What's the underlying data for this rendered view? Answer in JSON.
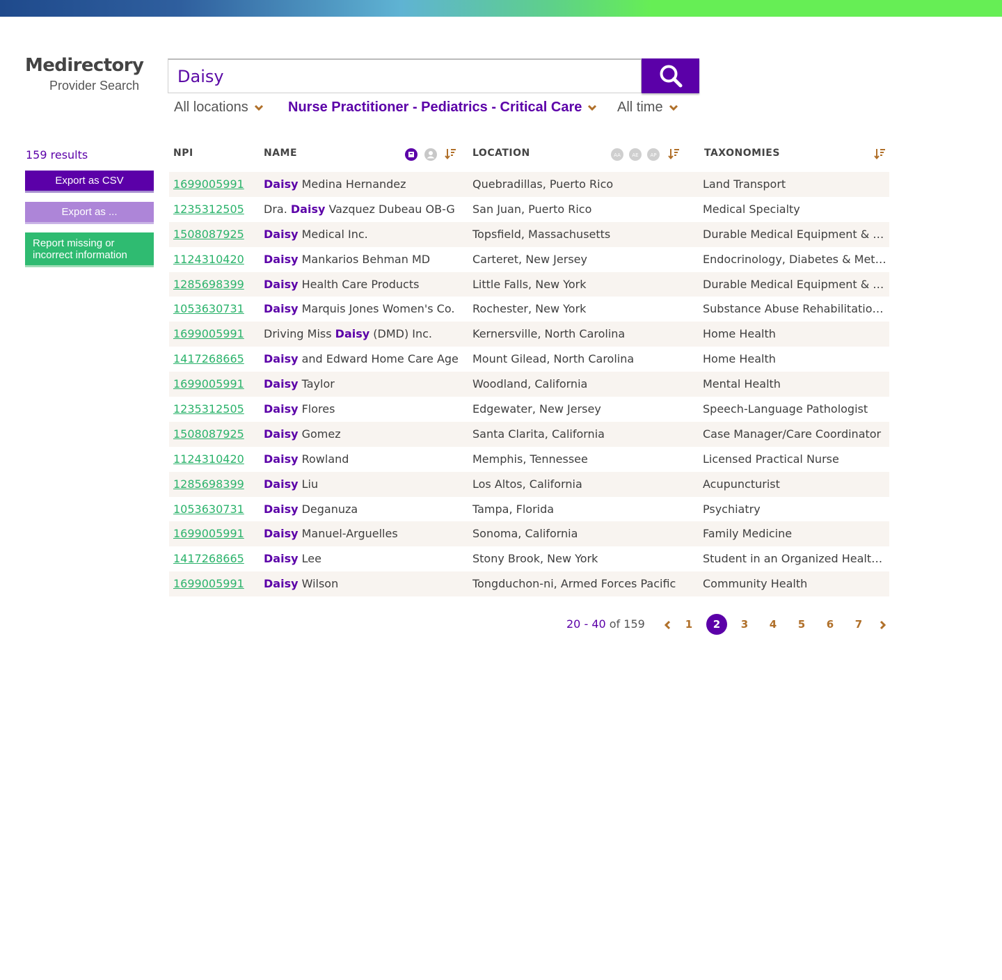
{
  "brand": {
    "title": "Medirectory",
    "subtitle": "Provider Search"
  },
  "search": {
    "value": "Daisy",
    "button_icon": "search-icon"
  },
  "filters": {
    "location": "All locations",
    "taxonomy": "Nurse Practitioner - Pediatrics - Critical Care",
    "time": "All time"
  },
  "sidebar": {
    "results": "159 results",
    "export_csv": "Export as CSV",
    "export_other": "Export as ...",
    "report_line1": "Report missing or",
    "report_line2": "incorrect information"
  },
  "table": {
    "headers": {
      "npi": "NPI",
      "name": "NAME",
      "location": "LOCATION",
      "taxonomies": "TAXONOMIES"
    },
    "name_filters": [
      "organization-icon",
      "person-icon"
    ],
    "location_badges": [
      "AA",
      "AE",
      "AP"
    ],
    "rows": [
      {
        "npi": "1699005991",
        "name_pre": "",
        "name_hl": "Daisy",
        "name_post": " Medina Hernandez",
        "location": "Quebradillas, Puerto Rico",
        "taxonomy": "Land Transport"
      },
      {
        "npi": "1235312505",
        "name_pre": "Dra. ",
        "name_hl": "Daisy",
        "name_post": " Vazquez Dubeau OB-G",
        "location": "San Juan, Puerto Rico",
        "taxonomy": "Medical Specialty"
      },
      {
        "npi": "1508087925",
        "name_pre": "",
        "name_hl": "Daisy",
        "name_post": " Medical Inc.",
        "location": "Topsfield, Massachusetts",
        "taxonomy": "Durable Medical Equipment & M..."
      },
      {
        "npi": "1124310420",
        "name_pre": "",
        "name_hl": "Daisy",
        "name_post": " Mankarios Behman MD",
        "location": "Carteret, New Jersey",
        "taxonomy": "Endocrinology, Diabetes & Meta..."
      },
      {
        "npi": "1285698399",
        "name_pre": "",
        "name_hl": "Daisy",
        "name_post": " Health Care Products",
        "location": "Little Falls, New York",
        "taxonomy": "Durable Medical Equipment & M..."
      },
      {
        "npi": "1053630731",
        "name_pre": "",
        "name_hl": "Daisy",
        "name_post": " Marquis Jones Women's Co.",
        "location": "Rochester, New York",
        "taxonomy": "Substance Abuse Rehabilitation ..."
      },
      {
        "npi": "1699005991",
        "name_pre": "Driving Miss ",
        "name_hl": "Daisy",
        "name_post": " (DMD) Inc.",
        "location": "Kernersville, North Carolina",
        "taxonomy": "Home Health"
      },
      {
        "npi": "1417268665",
        "name_pre": "",
        "name_hl": "Daisy",
        "name_post": " and Edward Home Care Age",
        "location": "Mount Gilead, North Carolina",
        "taxonomy": "Home Health"
      },
      {
        "npi": "1699005991",
        "name_pre": "",
        "name_hl": "Daisy",
        "name_post": " Taylor",
        "location": "Woodland, California",
        "taxonomy": "Mental Health"
      },
      {
        "npi": "1235312505",
        "name_pre": "",
        "name_hl": "Daisy",
        "name_post": " Flores",
        "location": "Edgewater, New Jersey",
        "taxonomy": "Speech-Language Pathologist"
      },
      {
        "npi": "1508087925",
        "name_pre": "",
        "name_hl": "Daisy",
        "name_post": " Gomez",
        "location": "Santa Clarita, California",
        "taxonomy": "Case Manager/Care Coordinator"
      },
      {
        "npi": "1124310420",
        "name_pre": "",
        "name_hl": "Daisy",
        "name_post": " Rowland",
        "location": "Memphis, Tennessee",
        "taxonomy": "Licensed Practical Nurse"
      },
      {
        "npi": "1285698399",
        "name_pre": "",
        "name_hl": "Daisy",
        "name_post": " Liu",
        "location": "Los Altos, California",
        "taxonomy": "Acupuncturist"
      },
      {
        "npi": "1053630731",
        "name_pre": "",
        "name_hl": "Daisy",
        "name_post": " Deganuza",
        "location": "Tampa, Florida",
        "taxonomy": "Psychiatry"
      },
      {
        "npi": "1699005991",
        "name_pre": "",
        "name_hl": "Daisy",
        "name_post": " Manuel-Arguelles",
        "location": "Sonoma, California",
        "taxonomy": "Family Medicine"
      },
      {
        "npi": "1417268665",
        "name_pre": "",
        "name_hl": "Daisy",
        "name_post": " Lee",
        "location": "Stony Brook, New York",
        "taxonomy": "Student in an Organized Health ..."
      },
      {
        "npi": "1699005991",
        "name_pre": "",
        "name_hl": "Daisy",
        "name_post": " Wilson",
        "location": "Tongduchon-ni, Armed Forces Pacific",
        "taxonomy": "Community Health"
      }
    ]
  },
  "pagination": {
    "range_start": "20",
    "range_sep": " - ",
    "range_end": "40",
    "of_label": " of ",
    "total": "159",
    "pages": [
      "1",
      "2",
      "3",
      "4",
      "5",
      "6",
      "7"
    ],
    "current": "2"
  },
  "colors": {
    "brand_purple": "#5b00a8",
    "link_green": "#2bb36b",
    "report_green": "#2fbb71",
    "accent_orange": "#b0702a",
    "row_stripe": "#f8f4f0"
  }
}
